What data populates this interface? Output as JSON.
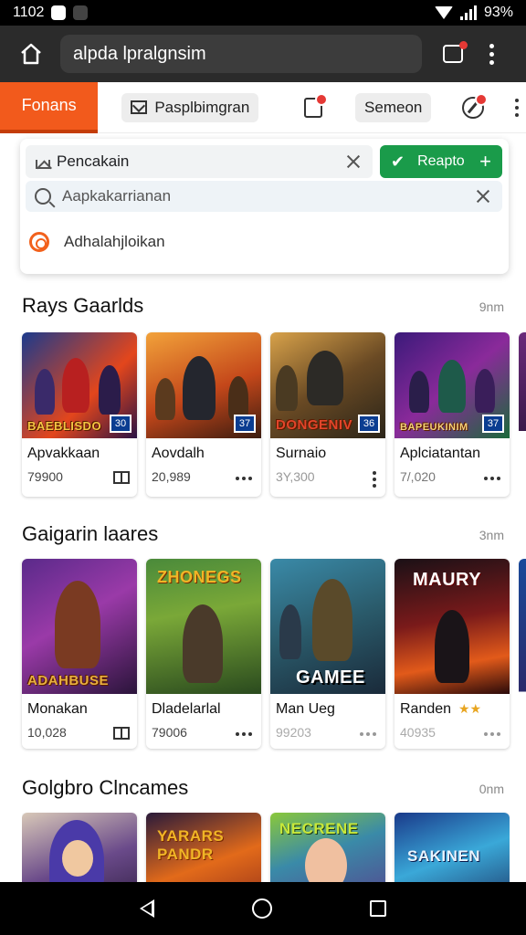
{
  "status": {
    "time": "1102",
    "battery": "93%"
  },
  "browser": {
    "url": "alpda lpralgnsim"
  },
  "nav": {
    "active_tab": "Fonans",
    "chip1": "Pasplbimgran",
    "chip2": "Semeon"
  },
  "search": {
    "field_text": "Pencakain",
    "go_label": "Reapto",
    "query_placeholder": "Aapkakarrianan",
    "suggestion": "Adhalahjloikan"
  },
  "sections": [
    {
      "title": "Rays Gaarlds",
      "link": "9nm",
      "items": [
        {
          "brand": "BAEBLISDO",
          "tag": "30",
          "title": "Apvakkaan",
          "count": "79900"
        },
        {
          "brand": "",
          "tag": "37",
          "title": "Aovdalh",
          "count": "20,989"
        },
        {
          "brand": "DONGENIV",
          "tag": "36",
          "title": "Surnaio",
          "count": "3Y,300"
        },
        {
          "brand": "BAPEUKINIM",
          "tag": "37",
          "title": "Aplciatantan",
          "count": "7/,020"
        }
      ]
    },
    {
      "title": "Gaigarin laares",
      "link": "3nm",
      "items": [
        {
          "brand": "ADAHBUSE",
          "title": "Monakan",
          "count": "10,028"
        },
        {
          "brand": "ZHONEGS",
          "title": "Dladelarlal",
          "count": "79006"
        },
        {
          "brand": "GAMEE",
          "title": "Man Ueg",
          "count": "99203"
        },
        {
          "brand": "MAURY",
          "title": "Randen",
          "count": "40935"
        }
      ]
    },
    {
      "title": "Golgbro Clncames",
      "link": "0nm",
      "items": [
        {
          "brand": ""
        },
        {
          "brand": "YARARS PANDR"
        },
        {
          "brand": "NECRENE"
        },
        {
          "brand": "SAKINEN"
        }
      ]
    }
  ],
  "colors": {
    "accent": "#f25a1c",
    "go": "#1a9b4a",
    "badge": "#e53935"
  }
}
